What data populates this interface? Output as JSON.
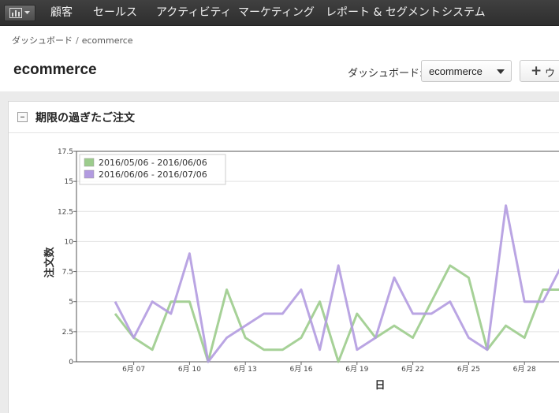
{
  "nav": {
    "items": [
      {
        "label": "顧客"
      },
      {
        "label": "セールス"
      },
      {
        "label": "アクティビティ"
      },
      {
        "label": "マーケティング"
      },
      {
        "label": "レポート & セグメント"
      },
      {
        "label": "システム"
      }
    ],
    "app_icon": "bar-chart-icon"
  },
  "breadcrumb": {
    "root": "ダッシュボード",
    "separator": "/",
    "current": "ecommerce"
  },
  "page": {
    "title": "ecommerce"
  },
  "dashboard_selector": {
    "label": "ダッシュボード:",
    "value": "ecommerce"
  },
  "add_button": {
    "label": "ウ"
  },
  "widget": {
    "title": "期限の過ぎたご注文"
  },
  "colors": {
    "series1": "#9ccc8c",
    "series2": "#b29be0",
    "nav_bg": "#333333"
  },
  "chart_data": {
    "type": "line",
    "xlabel": "日",
    "ylabel": "注文数",
    "ylim": [
      0,
      17.5
    ],
    "yticks": [
      "0",
      "2.5",
      "5",
      "7.5",
      "10",
      "12.5",
      "15",
      "17.5"
    ],
    "ytick_values": [
      0,
      2.5,
      5,
      7.5,
      10,
      12.5,
      15,
      17.5
    ],
    "x_day_first": 6,
    "x_day_last": 30,
    "xticks": [
      {
        "day": 7,
        "label": "6月 07"
      },
      {
        "day": 10,
        "label": "6月 10"
      },
      {
        "day": 13,
        "label": "6月 13"
      },
      {
        "day": 16,
        "label": "6月 16"
      },
      {
        "day": 19,
        "label": "6月 19"
      },
      {
        "day": 22,
        "label": "6月 22"
      },
      {
        "day": 25,
        "label": "6月 25"
      },
      {
        "day": 28,
        "label": "6月 28"
      }
    ],
    "legend_position": "top-left",
    "grid": true,
    "series": [
      {
        "name": "2016/05/06 - 2016/06/06",
        "color": "#9ccc8c",
        "values": [
          4,
          2,
          1,
          5,
          5,
          0,
          6,
          2,
          1,
          1,
          2,
          5,
          0,
          4,
          2,
          3,
          2,
          5,
          8,
          7,
          1,
          3,
          2,
          6,
          6
        ]
      },
      {
        "name": "2016/06/06 - 2016/07/06",
        "color": "#b29be0",
        "values": [
          5,
          2,
          5,
          4,
          9,
          0,
          2,
          3,
          4,
          4,
          6,
          1,
          8,
          1,
          2,
          7,
          4,
          4,
          5,
          2,
          1,
          13,
          5,
          5,
          8
        ]
      }
    ]
  }
}
